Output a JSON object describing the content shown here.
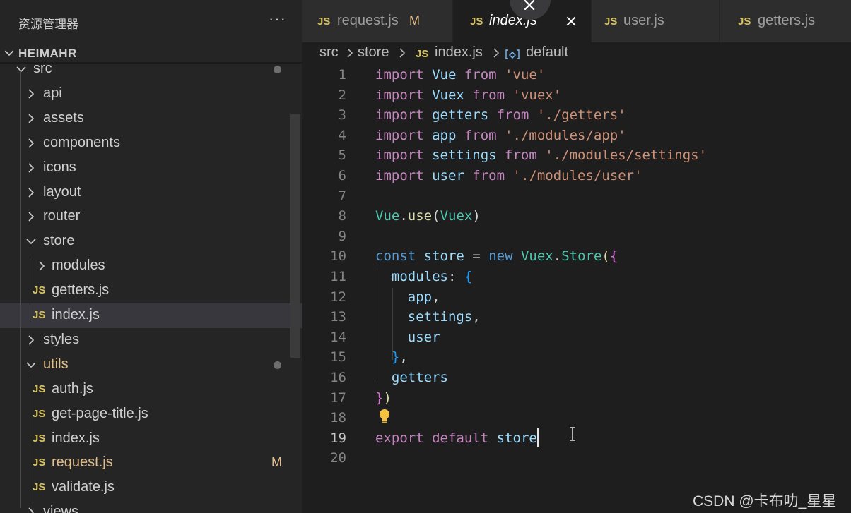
{
  "sidebar": {
    "title": "资源管理器",
    "more": "···",
    "root": "HEIMAHR",
    "tree": [
      {
        "label": "src",
        "type": "folder-open",
        "depth": 1,
        "dot": true
      },
      {
        "label": "api",
        "type": "folder",
        "depth": 2
      },
      {
        "label": "assets",
        "type": "folder",
        "depth": 2
      },
      {
        "label": "components",
        "type": "folder",
        "depth": 2
      },
      {
        "label": "icons",
        "type": "folder",
        "depth": 2
      },
      {
        "label": "layout",
        "type": "folder",
        "depth": 2
      },
      {
        "label": "router",
        "type": "folder",
        "depth": 2
      },
      {
        "label": "store",
        "type": "folder-open",
        "depth": 2
      },
      {
        "label": "modules",
        "type": "folder",
        "depth": 3
      },
      {
        "label": "getters.js",
        "type": "js",
        "depth": 3
      },
      {
        "label": "index.js",
        "type": "js",
        "depth": 3,
        "selected": true
      },
      {
        "label": "styles",
        "type": "folder",
        "depth": 2
      },
      {
        "label": "utils",
        "type": "folder-open",
        "depth": 2,
        "dot": true,
        "modified": true
      },
      {
        "label": "auth.js",
        "type": "js",
        "depth": 3
      },
      {
        "label": "get-page-title.js",
        "type": "js",
        "depth": 3
      },
      {
        "label": "index.js",
        "type": "js",
        "depth": 3
      },
      {
        "label": "request.js",
        "type": "js",
        "depth": 3,
        "status": "M",
        "modified": true
      },
      {
        "label": "validate.js",
        "type": "js",
        "depth": 3
      },
      {
        "label": "views",
        "type": "folder",
        "depth": 2
      }
    ]
  },
  "tabs": [
    {
      "label": "request.js",
      "status": "M",
      "modified": true,
      "active": false
    },
    {
      "label": "index.js",
      "active": true
    },
    {
      "label": "user.js",
      "active": false
    },
    {
      "label": "getters.js",
      "active": false
    }
  ],
  "js_badge": "JS",
  "breadcrumb": {
    "items": [
      "src",
      "store",
      "index.js",
      "default"
    ]
  },
  "editor": {
    "current_line": 19,
    "lines": [
      [
        {
          "t": "import",
          "c": "kw"
        },
        {
          "t": " Vue ",
          "c": "id"
        },
        {
          "t": "from",
          "c": "kw"
        },
        {
          "t": " ",
          "c": "pun"
        },
        {
          "t": "'vue'",
          "c": "str"
        }
      ],
      [
        {
          "t": "import",
          "c": "kw"
        },
        {
          "t": " Vuex ",
          "c": "id"
        },
        {
          "t": "from",
          "c": "kw"
        },
        {
          "t": " ",
          "c": "pun"
        },
        {
          "t": "'vuex'",
          "c": "str"
        }
      ],
      [
        {
          "t": "import",
          "c": "kw"
        },
        {
          "t": " getters ",
          "c": "id"
        },
        {
          "t": "from",
          "c": "kw"
        },
        {
          "t": " ",
          "c": "pun"
        },
        {
          "t": "'./getters'",
          "c": "str"
        }
      ],
      [
        {
          "t": "import",
          "c": "kw"
        },
        {
          "t": " app ",
          "c": "id"
        },
        {
          "t": "from",
          "c": "kw"
        },
        {
          "t": " ",
          "c": "pun"
        },
        {
          "t": "'./modules/app'",
          "c": "str"
        }
      ],
      [
        {
          "t": "import",
          "c": "kw"
        },
        {
          "t": " settings ",
          "c": "id"
        },
        {
          "t": "from",
          "c": "kw"
        },
        {
          "t": " ",
          "c": "pun"
        },
        {
          "t": "'./modules/settings'",
          "c": "str"
        }
      ],
      [
        {
          "t": "import",
          "c": "kw"
        },
        {
          "t": " user ",
          "c": "id"
        },
        {
          "t": "from",
          "c": "kw"
        },
        {
          "t": " ",
          "c": "pun"
        },
        {
          "t": "'./modules/user'",
          "c": "str"
        }
      ],
      [],
      [
        {
          "t": "Vue",
          "c": "cls"
        },
        {
          "t": ".",
          "c": "pun"
        },
        {
          "t": "use",
          "c": "fn"
        },
        {
          "t": "(",
          "c": "pun"
        },
        {
          "t": "Vuex",
          "c": "cls"
        },
        {
          "t": ")",
          "c": "pun"
        }
      ],
      [],
      [
        {
          "t": "const",
          "c": "kw2"
        },
        {
          "t": " store ",
          "c": "id"
        },
        {
          "t": "=",
          "c": "pun"
        },
        {
          "t": " ",
          "c": "pun"
        },
        {
          "t": "new",
          "c": "kw2"
        },
        {
          "t": " ",
          "c": "pun"
        },
        {
          "t": "Vuex",
          "c": "cls"
        },
        {
          "t": ".",
          "c": "pun"
        },
        {
          "t": "Store",
          "c": "cls"
        },
        {
          "t": "(",
          "c": "fn"
        },
        {
          "t": "{",
          "c": "br"
        }
      ],
      [
        {
          "t": "  modules",
          "c": "id"
        },
        {
          "t": ": ",
          "c": "pun"
        },
        {
          "t": "{",
          "c": "br2"
        }
      ],
      [
        {
          "t": "    app",
          "c": "id"
        },
        {
          "t": ",",
          "c": "pun"
        }
      ],
      [
        {
          "t": "    settings",
          "c": "id"
        },
        {
          "t": ",",
          "c": "pun"
        }
      ],
      [
        {
          "t": "    user",
          "c": "id"
        }
      ],
      [
        {
          "t": "  ",
          "c": "pun"
        },
        {
          "t": "}",
          "c": "br2"
        },
        {
          "t": ",",
          "c": "pun"
        }
      ],
      [
        {
          "t": "  getters",
          "c": "id"
        }
      ],
      [
        {
          "t": "}",
          "c": "br"
        },
        {
          "t": ")",
          "c": "fn"
        }
      ],
      [],
      [
        {
          "t": "export",
          "c": "kw"
        },
        {
          "t": " ",
          "c": "pun"
        },
        {
          "t": "default",
          "c": "kw"
        },
        {
          "t": " ",
          "c": "pun"
        },
        {
          "t": "store",
          "c": "id"
        }
      ],
      []
    ]
  },
  "watermark": "CSDN @卡布叻_星星",
  "colors": {
    "keyword": "#c586c0",
    "storage": "#569cd6",
    "variable": "#9cdcfe",
    "string": "#ce9178",
    "class": "#4ec9b0",
    "function": "#dcdcaa",
    "js_badge": "#d7c25c",
    "modified": "#e2c08d"
  }
}
